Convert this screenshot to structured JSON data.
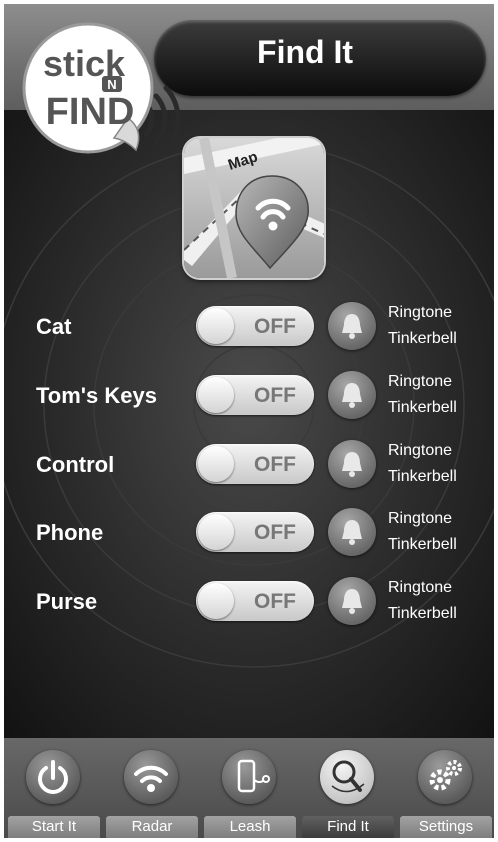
{
  "header": {
    "title": "Find It",
    "logo": {
      "line1": "stick",
      "mid": "N",
      "line2": "FIND"
    }
  },
  "map_button": {
    "label": "Map",
    "icon": "map-pin-icon"
  },
  "items": [
    {
      "name": "Cat",
      "toggle": "OFF",
      "ringtone_label": "Ringtone",
      "ringtone_value": "Tinkerbell"
    },
    {
      "name": "Tom's Keys",
      "toggle": "OFF",
      "ringtone_label": "Ringtone",
      "ringtone_value": "Tinkerbell"
    },
    {
      "name": "Control",
      "toggle": "OFF",
      "ringtone_label": "Ringtone",
      "ringtone_value": "Tinkerbell"
    },
    {
      "name": "Phone",
      "toggle": "OFF",
      "ringtone_label": "Ringtone",
      "ringtone_value": "Tinkerbell"
    },
    {
      "name": "Purse",
      "toggle": "OFF",
      "ringtone_label": "Ringtone",
      "ringtone_value": "Tinkerbell"
    }
  ],
  "tabs": [
    {
      "label": "Start It",
      "icon": "power-icon",
      "active": false
    },
    {
      "label": "Radar",
      "icon": "signal-icon",
      "active": false
    },
    {
      "label": "Leash",
      "icon": "phone-leash-icon",
      "active": false
    },
    {
      "label": "Find It",
      "icon": "magnifier-icon",
      "active": true
    },
    {
      "label": "Settings",
      "icon": "gears-icon",
      "active": false
    }
  ],
  "colors": {
    "background": "#111111",
    "header": "#7a7a7a",
    "title_bar": "#1a1a1a",
    "toggle": "#e0e0e0",
    "text": "#ffffff"
  }
}
